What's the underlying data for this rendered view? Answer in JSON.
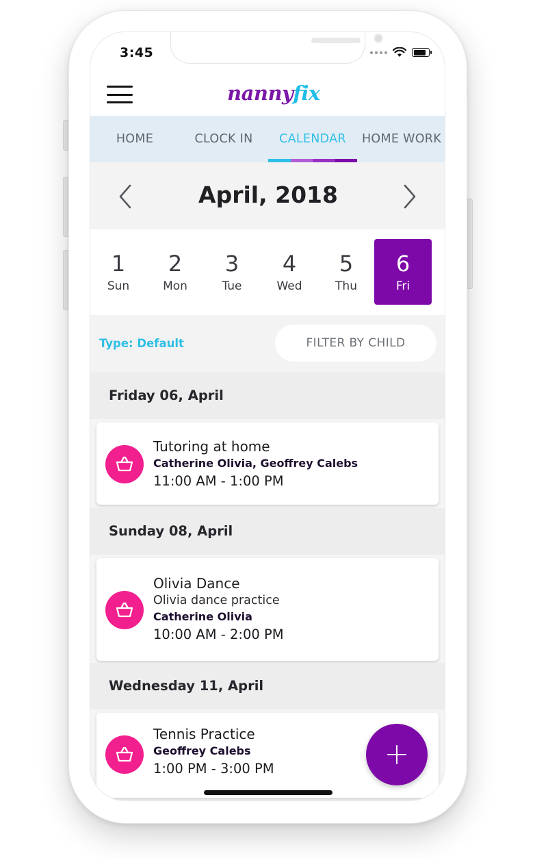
{
  "status_bar": {
    "time": "3:45"
  },
  "header": {
    "logo_part1": "nanny",
    "logo_part2": "fix"
  },
  "tabs": [
    {
      "label": "HOME",
      "active": false
    },
    {
      "label": "CLOCK IN",
      "active": false
    },
    {
      "label": "CALENDAR",
      "active": true
    },
    {
      "label": "HOME WORK",
      "active": false
    }
  ],
  "tab_underline_colors": [
    "#2fbfe6",
    "#b35ed8",
    "#9a2fc4",
    "#7d0aa8"
  ],
  "month": {
    "title": "April, 2018"
  },
  "days": [
    {
      "num": "1",
      "name": "Sun",
      "active": false
    },
    {
      "num": "2",
      "name": "Mon",
      "active": false
    },
    {
      "num": "3",
      "name": "Tue",
      "active": false
    },
    {
      "num": "4",
      "name": "Wed",
      "active": false
    },
    {
      "num": "5",
      "name": "Thu",
      "active": false
    },
    {
      "num": "6",
      "name": "Fri",
      "active": true
    }
  ],
  "filter": {
    "type_label": "Type: Default",
    "filter_button": "FILTER BY CHILD"
  },
  "sections": [
    {
      "date": "Friday 06, April",
      "events": [
        {
          "title": "Tutoring at home",
          "people": "Catherine Olivia, Geoffrey Calebs",
          "time": "11:00 AM - 1:00 PM"
        }
      ]
    },
    {
      "date": "Sunday 08, April",
      "events": [
        {
          "title": "Olivia Dance",
          "subtitle": "Olivia dance practice",
          "people": "Catherine Olivia",
          "time": "10:00 AM - 2:00 PM"
        }
      ]
    },
    {
      "date": "Wednesday 11, April",
      "events": [
        {
          "title": "Tennis Practice",
          "people": "Geoffrey Calebs",
          "time": "1:00 PM - 3:00 PM"
        }
      ]
    }
  ],
  "colors": {
    "accent_purple": "#7d0aa8",
    "accent_cyan": "#2fbfe6",
    "event_icon_pink": "#f21f8f"
  },
  "icons": {
    "event": "basket-icon",
    "fab": "plus-icon"
  }
}
